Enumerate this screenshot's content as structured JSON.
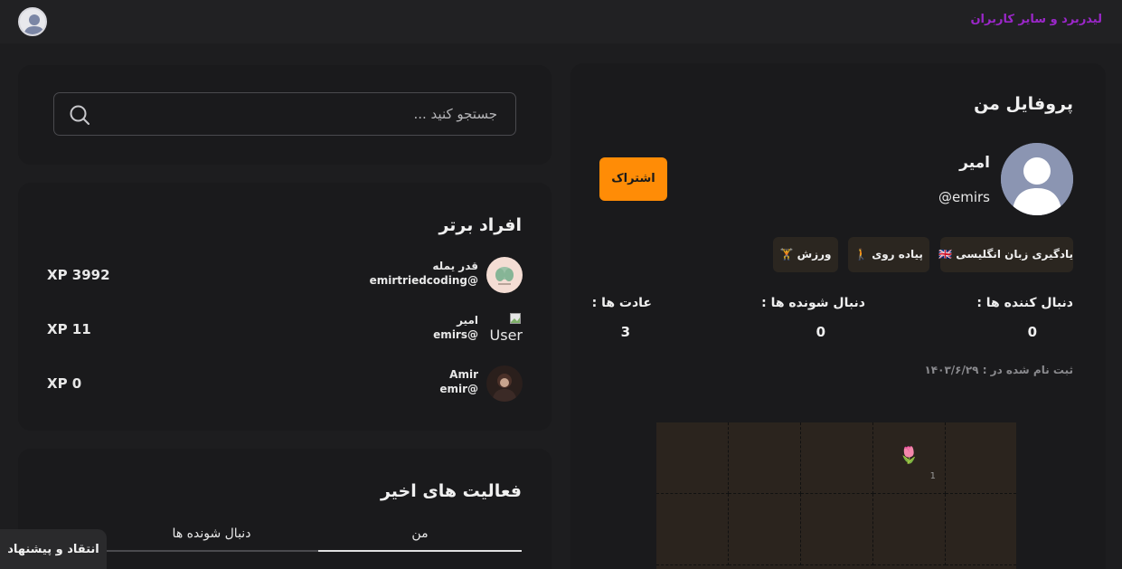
{
  "header": {
    "nav_link": "لیدربرد و سایر کاربران",
    "avatar_icon": "user-avatar-icon"
  },
  "search": {
    "placeholder": "جستجو کنید ...",
    "icon": "search-icon"
  },
  "leaderboard": {
    "title": "افراد برتر",
    "rows": [
      {
        "name": "قدر یمله",
        "handle": "emirtriedcoding@",
        "xp": "XP 3992",
        "avatar": "plant-avatar"
      },
      {
        "name": "امیر",
        "handle": "emirs@",
        "xp": "XP 11",
        "avatar": "broken-image",
        "alt": "User"
      },
      {
        "name": "Amir",
        "handle": "emir@",
        "xp": "XP 0",
        "avatar": "photo-avatar"
      }
    ]
  },
  "activity": {
    "title": "فعالیت های اخیر",
    "tabs": [
      "من",
      "دنبال شونده ها"
    ],
    "active_tab": "من"
  },
  "feedback": {
    "label": "انتقاد و پیشنهاد"
  },
  "profile": {
    "title": "پروفایل من",
    "name": "امیر",
    "handle": "@emirs",
    "share_label": "اشتراک",
    "habits": [
      {
        "label": "یادگیری زبان انگلیسی 🇬🇧"
      },
      {
        "label": "پیاده روی 🚶"
      },
      {
        "label": "ورزش 🏋️"
      }
    ],
    "stats": [
      {
        "label": "دنبال کننده ها :",
        "value": "0"
      },
      {
        "label": "دنبال شونده ها :",
        "value": "0"
      },
      {
        "label": "عادت ها :",
        "value": "3"
      }
    ],
    "joined": "ثبت نام شده در : ۱۴۰۳/۶/۲۹"
  },
  "heatmap": {
    "cells": [
      {
        "emoji": "",
        "count": ""
      },
      {
        "emoji": "",
        "count": ""
      },
      {
        "emoji": "",
        "count": ""
      },
      {
        "emoji": "🌷",
        "count": "1"
      },
      {
        "emoji": "",
        "count": ""
      },
      {
        "emoji": "",
        "count": ""
      },
      {
        "emoji": "",
        "count": ""
      },
      {
        "emoji": "",
        "count": ""
      },
      {
        "emoji": "",
        "count": ""
      },
      {
        "emoji": "",
        "count": ""
      }
    ]
  },
  "colors": {
    "accent_orange": "#ff8c06",
    "nav_purple": "#9b27c9"
  }
}
